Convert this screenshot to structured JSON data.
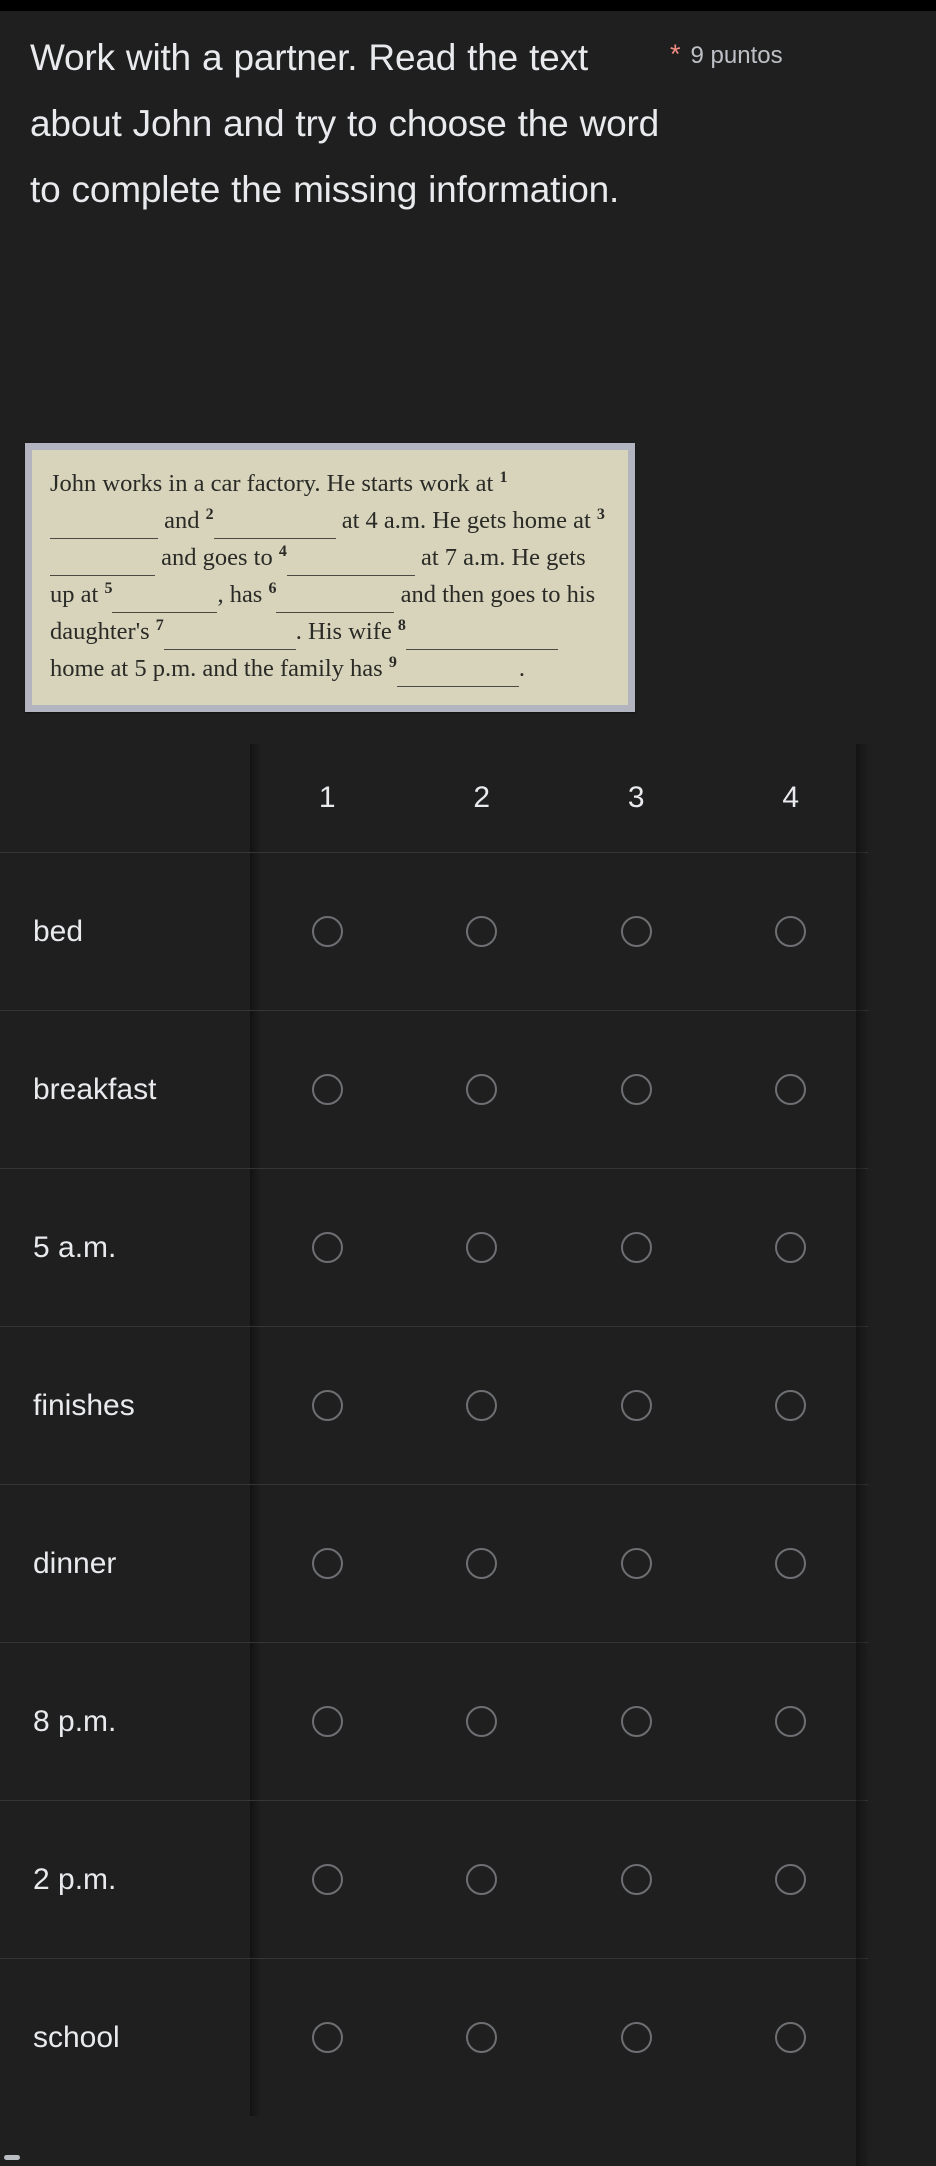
{
  "question": {
    "title": "Work with a partner. Read the text about John and try to choose the word to complete the missing information.",
    "required_marker": "*",
    "points_label": "9 puntos"
  },
  "passage": {
    "lines": [
      {
        "before": "John works in a car factory. He starts work at ",
        "number": "1",
        "after": ""
      },
      {
        "before": "and ",
        "number": "2",
        "after": " at 4 a.m. He gets home at "
      },
      {
        "before": "and goes to ",
        "number": "4",
        "after": " at 7 a.m. He gets up at "
      },
      {
        "before": "has ",
        "number": "6",
        "after": " and then goes to his daughter's"
      },
      {
        "before": "",
        "number": "7",
        "after": ". His wife "
      },
      {
        "before": "the family has ",
        "number": "9",
        "after": "."
      }
    ],
    "full_text": "John works in a car factory. He starts work at 1_____ and 2_____ at 4 a.m. He gets home at 3_____ and goes to 4_____ at 7 a.m. He gets up at 5_____, has 6_____ and then goes to his daughter's 7_____. His wife 8_____ home at 5 p.m. and the family has 9_____.",
    "fragments": {
      "f1": "John works in a car factory. He starts work at ",
      "f2": "and ",
      "f3": " at 4 a.m. He gets home at ",
      "f4": "and goes to ",
      "f5": " at 7 a.m. He gets up at ",
      "f6": "has ",
      "f7": " and then goes to his daughter's",
      "f8": ". His wife ",
      "f9": " home at 5 p.m. and",
      "f10": "the family has ",
      "f11": "."
    },
    "numbers": {
      "n1": "1",
      "n2": "2",
      "n3": "3",
      "n4": "4",
      "n5": "5",
      "n6": "6",
      "n7": "7",
      "n8": "8",
      "n9": "9"
    },
    "comma": ","
  },
  "grid": {
    "column_headers": [
      "1",
      "2",
      "3",
      "4"
    ],
    "rows": [
      {
        "label": "bed"
      },
      {
        "label": "breakfast"
      },
      {
        "label": "5 a.m."
      },
      {
        "label": "finishes"
      },
      {
        "label": "dinner"
      },
      {
        "label": "8 p.m."
      },
      {
        "label": "2 p.m."
      },
      {
        "label": "school"
      }
    ],
    "selected": []
  },
  "colors": {
    "background": "#1f1f1f",
    "text_primary": "#e8eaed",
    "text_secondary": "#bdc1c6",
    "required_star": "#f28b82",
    "passage_bg": "#d7d4bb",
    "passage_border": "#b2b5bf",
    "radio_border": "#6d6f72"
  }
}
